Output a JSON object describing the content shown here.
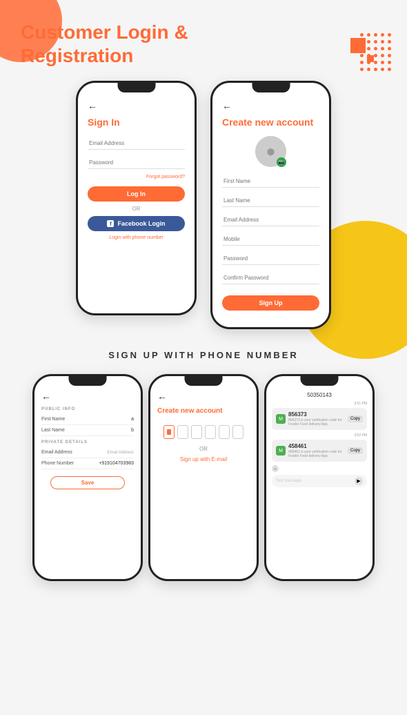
{
  "header": {
    "title_line1": "Customer Login &",
    "title_line2": "Registration"
  },
  "phone1": {
    "screen_title": "Sign In",
    "email_placeholder": "Email Address",
    "password_placeholder": "Password",
    "forgot_password": "Forgot password?",
    "login_button": "Log In",
    "or_text": "OR",
    "facebook_button": "Facebook Login",
    "phone_link": "Login with phone number"
  },
  "phone2": {
    "screen_title": "Create new account",
    "first_name": "First Name",
    "last_name": "Last Name",
    "email": "Email Address",
    "mobile": "Mobile",
    "password": "Password",
    "confirm_password": "Confirm Password",
    "signup_button": "Sign Up"
  },
  "section_label": "SIGN UP WITH PHONE NUMBER",
  "phone4": {
    "public_info": "PUBLIC INFO",
    "first_name_label": "First Name",
    "first_name_value": "a",
    "last_name_label": "Last Name",
    "last_name_value": "b",
    "private_details": "PRIVATE DETAILS",
    "email_label": "Email Address",
    "email_placeholder": "Email Address",
    "phone_label": "Phone Number",
    "phone_value": "+919104703983",
    "save_button": "Save"
  },
  "phone5": {
    "screen_title": "Create new account",
    "or_text": "OR",
    "signup_email_link": "Sign up with E-mail"
  },
  "phone6": {
    "phone_number": "50350143",
    "code1": "856373",
    "code1_label": "Copy",
    "code1_desc": "856373 is your verification code for Foodie Food delivery App.",
    "code2": "458461",
    "code2_label": "Copy",
    "code2_desc": "458461 is your verification code for Foodie Food delivery App.",
    "text_placeholder": "Text message",
    "time1": "3:51 PM",
    "time2": "3:52 PM"
  }
}
